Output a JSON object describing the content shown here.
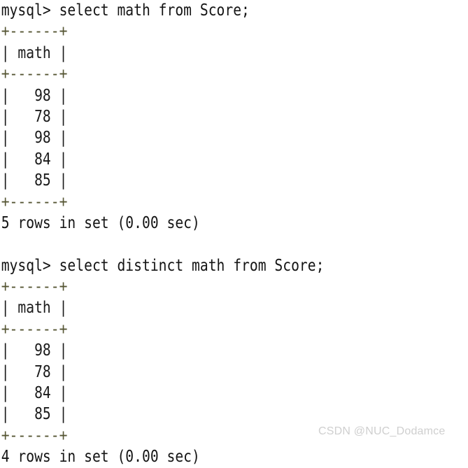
{
  "terminal": {
    "prompt": "mysql>",
    "lines": [
      {
        "type": "prompt",
        "text": "mysql> select math from Score;"
      },
      {
        "type": "border",
        "text": "+------+"
      },
      {
        "type": "rowline",
        "text": "| math |"
      },
      {
        "type": "border",
        "text": "+------+"
      },
      {
        "type": "rowline",
        "text": "|   98 |"
      },
      {
        "type": "rowline",
        "text": "|   78 |"
      },
      {
        "type": "rowline",
        "text": "|   98 |"
      },
      {
        "type": "rowline",
        "text": "|   84 |"
      },
      {
        "type": "rowline",
        "text": "|   85 |"
      },
      {
        "type": "border",
        "text": "+------+"
      },
      {
        "type": "status",
        "text": "5 rows in set (0.00 sec)"
      },
      {
        "type": "blank",
        "text": " "
      },
      {
        "type": "prompt",
        "text": "mysql> select distinct math from Score;"
      },
      {
        "type": "border",
        "text": "+------+"
      },
      {
        "type": "rowline",
        "text": "| math |"
      },
      {
        "type": "border",
        "text": "+------+"
      },
      {
        "type": "rowline",
        "text": "|   98 |"
      },
      {
        "type": "rowline",
        "text": "|   78 |"
      },
      {
        "type": "rowline",
        "text": "|   84 |"
      },
      {
        "type": "rowline",
        "text": "|   85 |"
      },
      {
        "type": "border",
        "text": "+------+"
      },
      {
        "type": "status",
        "text": "4 rows in set (0.00 sec)"
      }
    ],
    "queries": [
      {
        "sql": "select math from Score;",
        "column": "math",
        "values": [
          98,
          78,
          98,
          84,
          85
        ],
        "result": "5 rows in set (0.00 sec)",
        "row_count": 5,
        "duration_sec": "0.00"
      },
      {
        "sql": "select distinct math from Score;",
        "column": "math",
        "values": [
          98,
          78,
          84,
          85
        ],
        "result": "4 rows in set (0.00 sec)",
        "row_count": 4,
        "duration_sec": "0.00"
      }
    ]
  },
  "watermark": {
    "text": "CSDN @NUC_Dodamce",
    "color": "#cfcfcf"
  },
  "colors": {
    "background": "#ffffff",
    "text": "#1a1a1a",
    "border_char": "#555533",
    "watermark": "#cfcfcf"
  }
}
